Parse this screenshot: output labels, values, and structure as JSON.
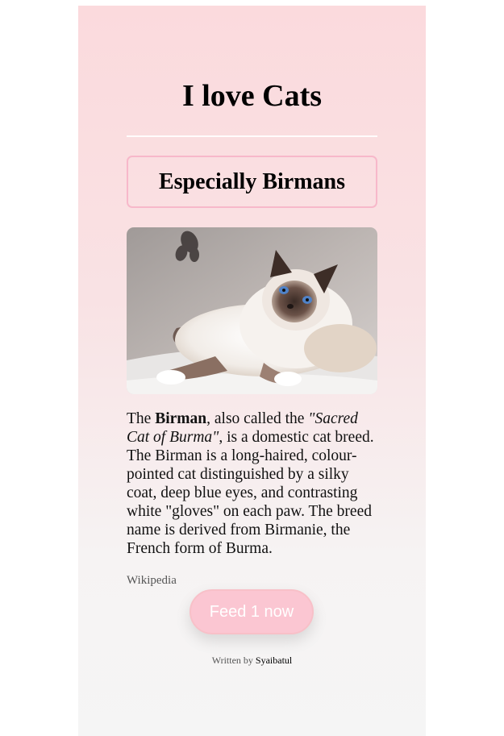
{
  "header": {
    "title": "I love Cats",
    "subtitle": "Especially Birmans"
  },
  "article": {
    "p1": "The ",
    "name": "Birman",
    "p2": ", also called the ",
    "alt_name": "\"Sacred Cat of Burma\"",
    "p3": ", is a domestic cat breed. The Birman is a long-haired, colour-pointed cat distinguished by a silky coat, deep blue eyes, and contrasting white \"gloves\" on each paw. The breed name is derived from Birmanie, the French form of Burma.",
    "source": "Wikipedia"
  },
  "actions": {
    "feed_label": "Feed 1 now"
  },
  "footer": {
    "prefix": "Written by ",
    "author": "Syaibatul"
  },
  "colors": {
    "accent_border": "#f7b8ca",
    "button_bg": "#fbc6d2",
    "gradient_top": "#fbdadd",
    "gradient_bottom": "#f5f5f5"
  }
}
